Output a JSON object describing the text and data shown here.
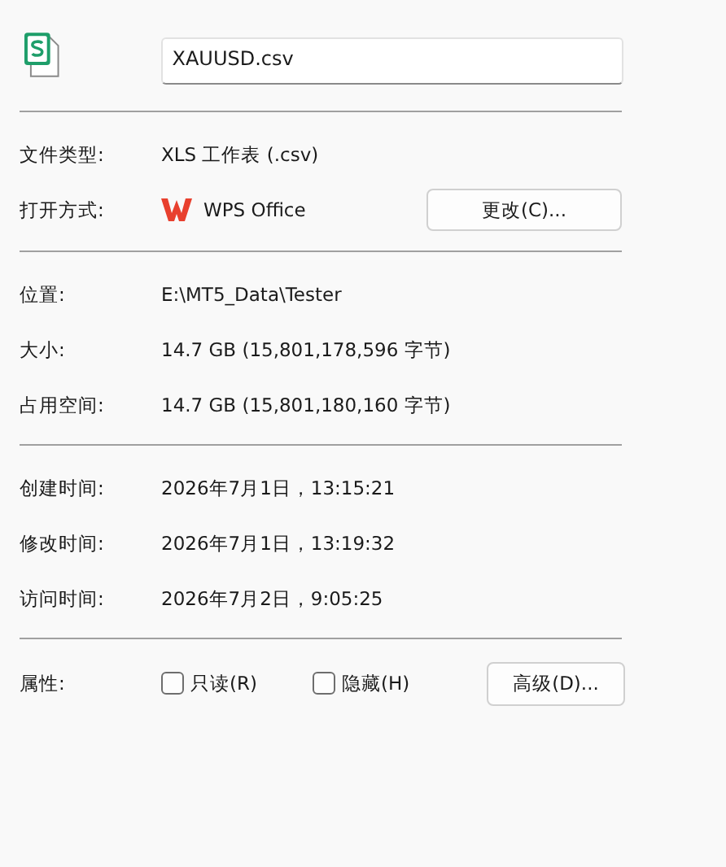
{
  "file": {
    "name": "XAUUSD.csv"
  },
  "type_row": {
    "label": "文件类型:",
    "value": "XLS 工作表 (.csv)"
  },
  "open_with": {
    "label": "打开方式:",
    "app": "WPS Office",
    "button": "更改(C)..."
  },
  "details": [
    {
      "label": "位置:",
      "value": "E:\\MT5_Data\\Tester"
    },
    {
      "label": "大小:",
      "value": "14.7 GB (15,801,178,596 字节)"
    },
    {
      "label": "占用空间:",
      "value": "14.7 GB (15,801,180,160 字节)"
    }
  ],
  "times": [
    {
      "label": "创建时间:",
      "value": "2026年7月1日，13:15:21"
    },
    {
      "label": "修改时间:",
      "value": "2026年7月1日，13:19:32"
    },
    {
      "label": "访问时间:",
      "value": "2026年7月2日，9:05:25"
    }
  ],
  "attributes": {
    "label": "属性:",
    "checkboxes": [
      {
        "label": "只读(R)",
        "checked": false
      },
      {
        "label": "隐藏(H)",
        "checked": false
      }
    ],
    "button": "高级(D)..."
  }
}
